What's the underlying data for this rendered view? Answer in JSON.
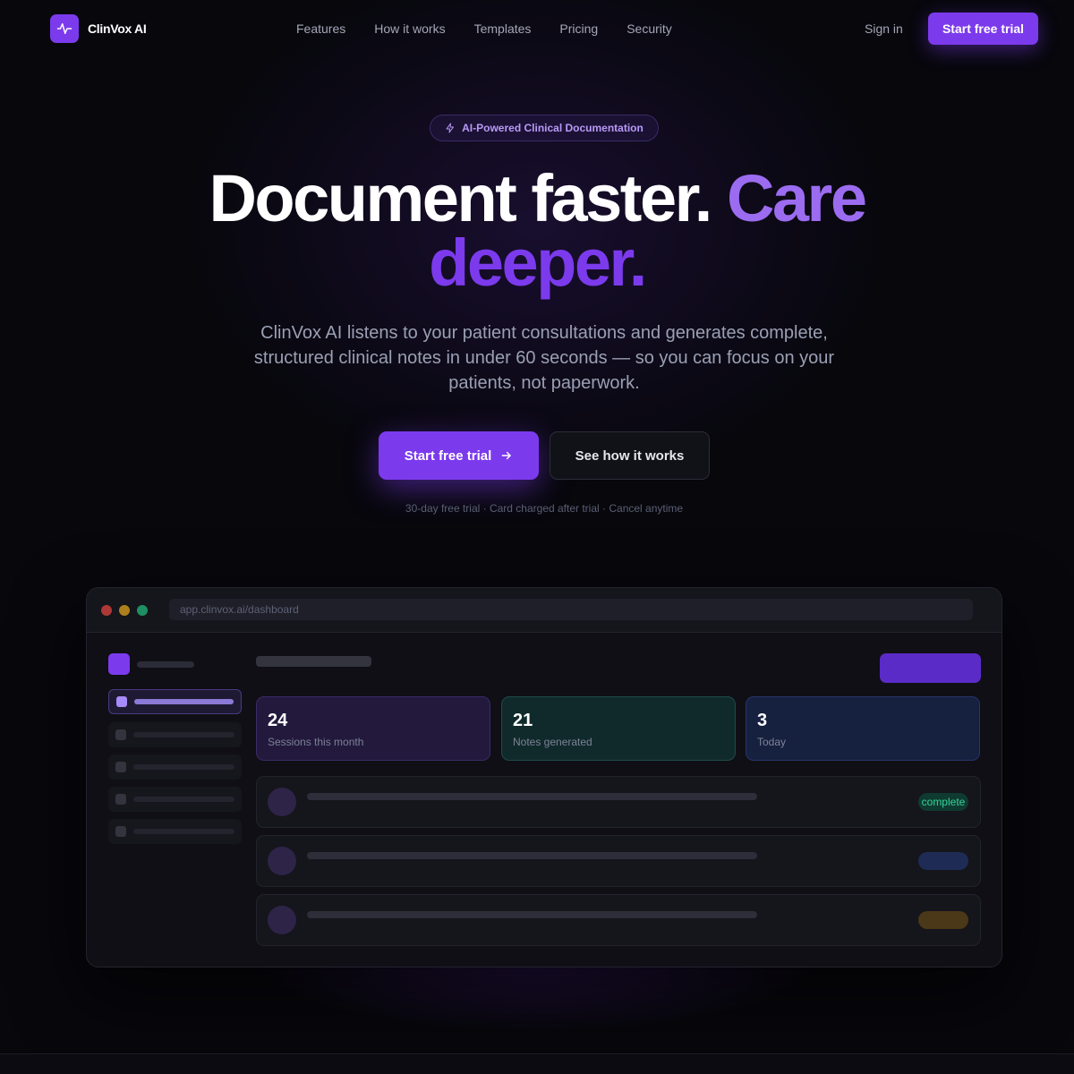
{
  "brand": {
    "name": "ClinVox AI",
    "accent": "#7c3aed",
    "logo_icon": "pulse-icon"
  },
  "nav": {
    "links": [
      "Features",
      "How it works",
      "Templates",
      "Pricing",
      "Security"
    ],
    "sign_in": "Sign in",
    "cta": "Start free trial"
  },
  "hero": {
    "badge_icon": "sparkle-icon",
    "badge": "AI-Powered Clinical Documentation",
    "headline_part1": "Document faster.",
    "headline_part2": "Care",
    "headline_part3": "deeper.",
    "subheadline": "ClinVox AI listens to your patient consultations and generates complete, structured clinical notes in under 60 seconds — so you can focus on your patients, not paperwork.",
    "primary_cta": "Start free trial",
    "primary_cta_icon": "arrow-right-icon",
    "secondary_cta": "See how it works",
    "fineprint": "30-day free trial · Card charged after trial · Cancel anytime"
  },
  "mockup": {
    "url": "app.clinvox.ai/dashboard",
    "stats": [
      {
        "value": "24",
        "label": "Sessions this month"
      },
      {
        "value": "21",
        "label": "Notes generated"
      },
      {
        "value": "3",
        "label": "Today"
      }
    ],
    "rows": [
      {
        "status": "complete"
      },
      {
        "status": ""
      },
      {
        "status": ""
      }
    ]
  }
}
